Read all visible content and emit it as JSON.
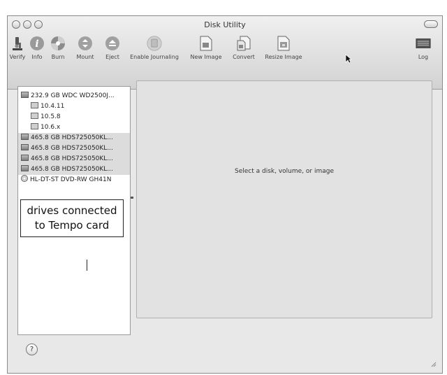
{
  "window": {
    "title": "Disk Utility"
  },
  "toolbar": {
    "items": [
      {
        "label": "Verify",
        "icon": "microscope-icon"
      },
      {
        "label": "Info",
        "icon": "info-icon"
      },
      {
        "label": "Burn",
        "icon": "burn-icon"
      },
      {
        "label": "Mount",
        "icon": "mount-icon"
      },
      {
        "label": "Eject",
        "icon": "eject-icon"
      },
      {
        "label": "Enable Journaling",
        "icon": "journaling-icon"
      },
      {
        "label": "New Image",
        "icon": "new-image-icon"
      },
      {
        "label": "Convert",
        "icon": "convert-icon"
      },
      {
        "label": "Resize Image",
        "icon": "resize-image-icon"
      },
      {
        "label": "Log",
        "icon": "log-icon"
      }
    ]
  },
  "sidebar": {
    "items": [
      {
        "label": "232.9 GB WDC WD2500J...",
        "kind": "disk"
      },
      {
        "label": "10.4.11",
        "kind": "volume"
      },
      {
        "label": "10.5.8",
        "kind": "volume"
      },
      {
        "label": "10.6.x",
        "kind": "volume"
      },
      {
        "label": "465.8 GB HDS725050KL...",
        "kind": "disk"
      },
      {
        "label": "465.8 GB HDS725050KL...",
        "kind": "disk"
      },
      {
        "label": "465.8 GB HDS725050KL...",
        "kind": "disk"
      },
      {
        "label": "465.8 GB HDS725050KL...",
        "kind": "disk"
      },
      {
        "label": "HL-DT-ST DVD-RW GH41N",
        "kind": "optical"
      }
    ]
  },
  "callout": {
    "line1": "drives connected",
    "line2": "to Tempo card"
  },
  "main": {
    "message": "Select a disk, volume, or image"
  },
  "footer": {
    "help_label": "?"
  },
  "colors": {
    "chrome": "#d8d8d8",
    "panel": "#e2e2e2",
    "selection": "#dcdcdc"
  }
}
